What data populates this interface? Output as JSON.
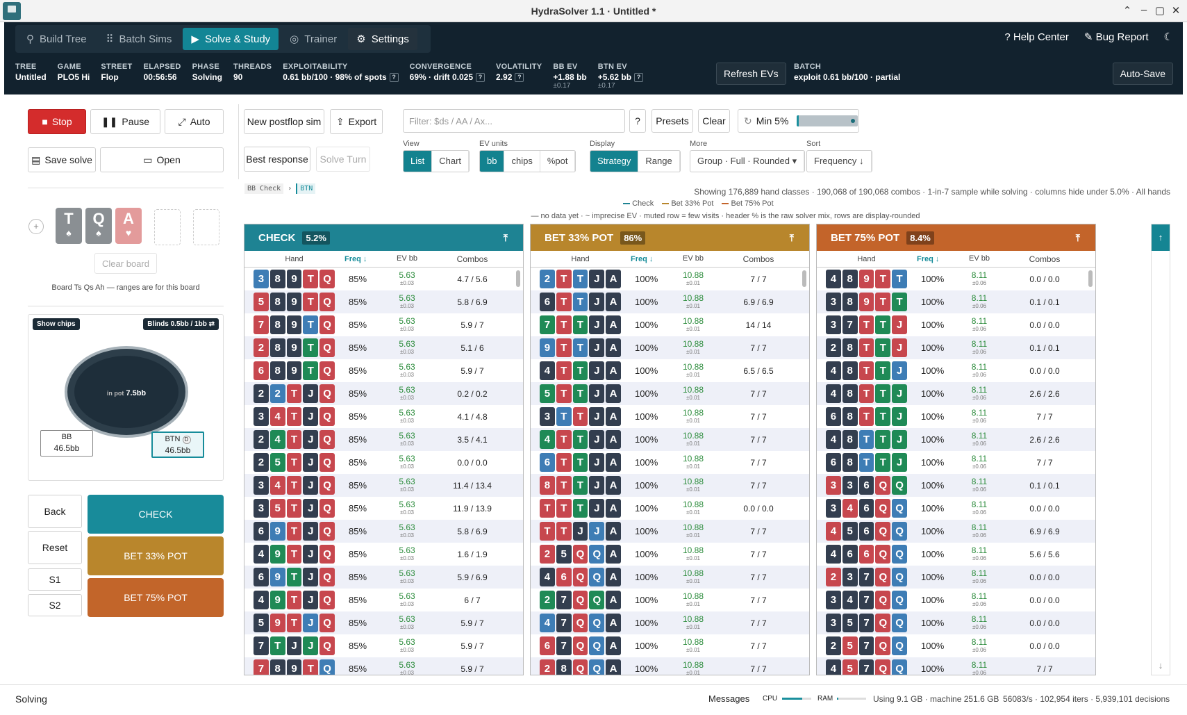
{
  "window": {
    "title": "HydraSolver 1.1 · Untitled *"
  },
  "nav": {
    "tabs": [
      "Build Tree",
      "Batch Sims",
      "Solve & Study",
      "Trainer",
      "Settings"
    ],
    "help": "Help Center",
    "bug": "Bug Report"
  },
  "stats": [
    {
      "k": "TREE",
      "v": "Untitled"
    },
    {
      "k": "GAME",
      "v": "PLO5 Hi"
    },
    {
      "k": "STREET",
      "v": "Flop"
    },
    {
      "k": "ELAPSED",
      "v": "00:56:56"
    },
    {
      "k": "PHASE",
      "v": "Solving"
    },
    {
      "k": "THREADS",
      "v": "90"
    },
    {
      "k": "EXPLOITABILITY",
      "v": "0.61 bb/100 · 98% of spots"
    },
    {
      "k": "CONVERGENCE",
      "v": "69% · drift 0.025"
    },
    {
      "k": "VOLATILITY",
      "v": "2.92"
    }
  ],
  "ev": {
    "bb_k": "BB EV",
    "bb_v": "+1.88 bb",
    "bb_s": "±0.17",
    "btn_k": "BTN EV",
    "btn_v": "+5.62 bb",
    "btn_s": "±0.17"
  },
  "refresh": "Refresh EVs",
  "batch": {
    "k": "BATCH",
    "v": "exploit 0.61 bb/100 · partial"
  },
  "autosave": "Auto-Save",
  "left": {
    "stop": "Stop",
    "pause": "Pause",
    "auto": "Auto",
    "save": "Save solve",
    "open": "Open",
    "clear_board": "Clear board",
    "board_note": "Board Ts Qs Ah — ranges are for this board",
    "show_chips": "Show chips",
    "blinds": "Blinds 0.5bb / 1bb ⇄",
    "in_pot": "in pot",
    "pot": "7.5bb",
    "bb_seat": "BB",
    "bb_stack": "46.5bb",
    "btn_seat": "BTN",
    "btn_stack": "46.5bb",
    "back": "Back",
    "reset": "Reset",
    "s1": "S1",
    "s2": "S2",
    "check": "CHECK",
    "bet33": "BET 33% POT",
    "bet75": "BET 75% POT"
  },
  "board": [
    {
      "r": "T",
      "s": "♠"
    },
    {
      "r": "Q",
      "s": "♠"
    },
    {
      "r": "A",
      "s": "♥"
    }
  ],
  "mid": {
    "new_sim": "New postflop sim",
    "export": "Export",
    "best": "Best response",
    "solve_turn": "Solve Turn"
  },
  "filter": {
    "placeholder": "Filter: $ds / AA / Ax...",
    "help": "?",
    "presets": "Presets",
    "clear": "Clear",
    "min": "Min 5%"
  },
  "labels": {
    "view": "View",
    "ev_units": "EV units",
    "display": "Display",
    "more": "More",
    "sort": "Sort"
  },
  "view": [
    "List",
    "Chart"
  ],
  "units": [
    "bb",
    "chips",
    "%pot"
  ],
  "display": [
    "Strategy",
    "Range"
  ],
  "more_value": "Group · Full · Rounded ▾",
  "sort_value": "Frequency ↓",
  "crumb": {
    "a": "BB Check",
    "b": "BTN"
  },
  "info1": "Showing 176,889 hand classes · 190,068 of 190,068 combos · 1-in-7 sample while solving · columns hide under 5.0% · All hands",
  "legend": [
    "Check",
    "Bet 33% Pot",
    "Bet 75% Pot"
  ],
  "info2": "— no data yet · ~ imprecise EV · muted row = few visits · header % is the raw solver mix, rows are display-rounded",
  "table_headers": {
    "hand": "Hand",
    "freq": "Freq ↓",
    "ev": "EV bb",
    "combos": "Combos"
  },
  "columns": [
    {
      "title": "CHECK",
      "pct": "5.2%",
      "color": "#1e8393",
      "ev": "5.63",
      "evs": "±0.03",
      "freq": "85%",
      "rows": [
        [
          "3b",
          "8d",
          "9d",
          "Tr",
          "Qr",
          "4.7 / 5.6"
        ],
        [
          "5r",
          "8d",
          "9d",
          "Tr",
          "Qr",
          "5.8 / 6.9"
        ],
        [
          "7r",
          "8d",
          "9d",
          "Tb",
          "Qr",
          "5.9 / 7"
        ],
        [
          "2r",
          "8d",
          "9d",
          "Tg",
          "Qr",
          "5.1 / 6"
        ],
        [
          "6r",
          "8d",
          "9d",
          "Tg",
          "Qr",
          "5.9 / 7"
        ],
        [
          "2d",
          "2b",
          "Tr",
          "Jd",
          "Qr",
          "0.2 / 0.2"
        ],
        [
          "3d",
          "4r",
          "Tr",
          "Jd",
          "Qr",
          "4.1 / 4.8"
        ],
        [
          "2d",
          "4g",
          "Tr",
          "Jd",
          "Qr",
          "3.5 / 4.1"
        ],
        [
          "2d",
          "5g",
          "Tr",
          "Jd",
          "Qr",
          "0.0 / 0.0"
        ],
        [
          "3d",
          "4r",
          "Tr",
          "Jd",
          "Qr",
          "11.4 / 13.4"
        ],
        [
          "3d",
          "5r",
          "Tr",
          "Jd",
          "Qr",
          "11.9 / 13.9"
        ],
        [
          "6d",
          "9b",
          "Tr",
          "Jd",
          "Qr",
          "5.8 / 6.9"
        ],
        [
          "4d",
          "9g",
          "Tr",
          "Jd",
          "Qr",
          "1.6 / 1.9"
        ],
        [
          "6d",
          "9b",
          "Tg",
          "Jd",
          "Qr",
          "5.9 / 6.9"
        ],
        [
          "4d",
          "9g",
          "Tr",
          "Jd",
          "Qr",
          "6 / 7"
        ],
        [
          "5d",
          "9r",
          "Tr",
          "Jb",
          "Qr",
          "5.9 / 7"
        ],
        [
          "7d",
          "Tg",
          "Jd",
          "Jg",
          "Qr",
          "5.9 / 7"
        ],
        [
          "7r",
          "8d",
          "9d",
          "Tr",
          "Qb",
          "5.9 / 7"
        ]
      ]
    },
    {
      "title": "BET 33% POT",
      "pct": "86%",
      "color": "#b8862c",
      "ev": "10.88",
      "evs": "±0.01",
      "freq": "100%",
      "rows": [
        [
          "2b",
          "Tr",
          "Tb",
          "Jd",
          "Ad",
          "7 / 7"
        ],
        [
          "6d",
          "Tr",
          "Tb",
          "Jd",
          "Ad",
          "6.9 / 6.9"
        ],
        [
          "7g",
          "Tr",
          "Tg",
          "Jd",
          "Ad",
          "14 / 14"
        ],
        [
          "9b",
          "Tr",
          "Tb",
          "Jd",
          "Ad",
          "7 / 7"
        ],
        [
          "4d",
          "Tr",
          "Tg",
          "Jd",
          "Ad",
          "6.5 / 6.5"
        ],
        [
          "5g",
          "Tr",
          "Tg",
          "Jd",
          "Ad",
          "7 / 7"
        ],
        [
          "3d",
          "Tb",
          "Tr",
          "Jd",
          "Ad",
          "7 / 7"
        ],
        [
          "4g",
          "Tr",
          "Tg",
          "Jd",
          "Ad",
          "7 / 7"
        ],
        [
          "6b",
          "Tr",
          "Tg",
          "Jd",
          "Ad",
          "7 / 7"
        ],
        [
          "8r",
          "Tr",
          "Tg",
          "Jd",
          "Ad",
          "7 / 7"
        ],
        [
          "Tr",
          "Tr",
          "Tg",
          "Jd",
          "Ad",
          "0.0 / 0.0"
        ],
        [
          "Tr",
          "Tr",
          "Jd",
          "Jb",
          "Ad",
          "7 / 7"
        ],
        [
          "2r",
          "5d",
          "Qr",
          "Qb",
          "Ad",
          "7 / 7"
        ],
        [
          "4d",
          "6r",
          "Qr",
          "Qb",
          "Ad",
          "7 / 7"
        ],
        [
          "2g",
          "7d",
          "Qr",
          "Qg",
          "Ad",
          "7 / 7"
        ],
        [
          "4b",
          "7d",
          "Qr",
          "Qb",
          "Ad",
          "7 / 7"
        ],
        [
          "6r",
          "7d",
          "Qr",
          "Qb",
          "Ad",
          "7 / 7"
        ],
        [
          "2r",
          "8d",
          "Qr",
          "Qb",
          "Ad",
          "7 / 7"
        ]
      ]
    },
    {
      "title": "BET 75% POT",
      "pct": "8.4%",
      "color": "#c3642a",
      "ev": "8.11",
      "evs": "±0.06",
      "freq": "100%",
      "rows": [
        [
          "4d",
          "8d",
          "9r",
          "Tr",
          "Tb",
          "0.0 / 0.0"
        ],
        [
          "3d",
          "8d",
          "9r",
          "Tr",
          "Tg",
          "0.1 / 0.1"
        ],
        [
          "3d",
          "7d",
          "Tr",
          "Tg",
          "Jr",
          "0.0 / 0.0"
        ],
        [
          "2d",
          "8d",
          "Tr",
          "Tg",
          "Jr",
          "0.1 / 0.1"
        ],
        [
          "4d",
          "8d",
          "Tr",
          "Tg",
          "Jb",
          "0.0 / 0.0"
        ],
        [
          "4d",
          "8d",
          "Tr",
          "Tg",
          "Jg",
          "2.6 / 2.6"
        ],
        [
          "6d",
          "8d",
          "Tr",
          "Tg",
          "Jg",
          "7 / 7"
        ],
        [
          "4d",
          "8d",
          "Tb",
          "Tg",
          "Jg",
          "2.6 / 2.6"
        ],
        [
          "6d",
          "8d",
          "Tb",
          "Tg",
          "Jg",
          "7 / 7"
        ],
        [
          "3r",
          "3d",
          "6d",
          "Qr",
          "Qg",
          "0.1 / 0.1"
        ],
        [
          "3d",
          "4r",
          "6d",
          "Qr",
          "Qb",
          "0.0 / 0.0"
        ],
        [
          "4r",
          "5d",
          "6d",
          "Qr",
          "Qb",
          "6.9 / 6.9"
        ],
        [
          "4d",
          "6d",
          "6r",
          "Qr",
          "Qb",
          "5.6 / 5.6"
        ],
        [
          "2r",
          "3d",
          "7d",
          "Qr",
          "Qb",
          "0.0 / 0.0"
        ],
        [
          "3d",
          "4d",
          "7d",
          "Qr",
          "Qb",
          "0.0 / 0.0"
        ],
        [
          "3d",
          "5d",
          "7d",
          "Qr",
          "Qb",
          "0.0 / 0.0"
        ],
        [
          "2d",
          "5r",
          "7d",
          "Qr",
          "Qb",
          "0.0 / 0.0"
        ],
        [
          "4d",
          "5r",
          "7d",
          "Qr",
          "Qb",
          "7 / 7"
        ]
      ]
    }
  ],
  "status": {
    "left": "Solving",
    "messages": "Messages",
    "cpu": "CPU",
    "ram": "RAM",
    "using": "Using 9.1 GB · machine 251.6 GB",
    "rate": "56083/s · 102,954 iters · 5,939,101 decisions"
  }
}
